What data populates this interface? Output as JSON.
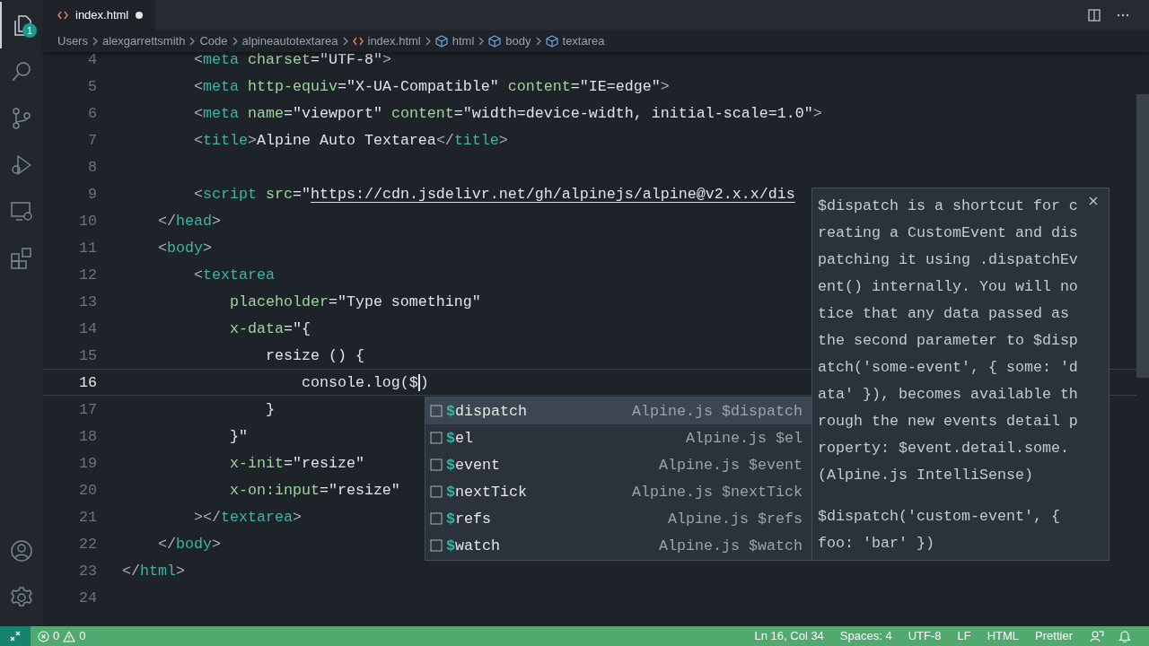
{
  "activity_bar": {
    "items": [
      {
        "kind": "files",
        "selected": true,
        "badge": "1"
      },
      {
        "kind": "search",
        "selected": false
      },
      {
        "kind": "source_control",
        "selected": false
      },
      {
        "kind": "run_debug",
        "selected": false
      },
      {
        "kind": "remote",
        "selected": false
      },
      {
        "kind": "extensions",
        "selected": false
      }
    ],
    "bottom": [
      {
        "kind": "account"
      },
      {
        "kind": "settings"
      }
    ]
  },
  "tabs": [
    {
      "label": "index.html",
      "selected": true,
      "modified": true
    }
  ],
  "breadcrumbs": [
    {
      "label": "Users",
      "kind": "folder"
    },
    {
      "label": "alexgarrettsmith",
      "kind": "folder"
    },
    {
      "label": "Code",
      "kind": "folder"
    },
    {
      "label": "alpineautotextarea",
      "kind": "folder"
    },
    {
      "label": "index.html",
      "kind": "file"
    },
    {
      "label": "html",
      "kind": "element"
    },
    {
      "label": "body",
      "kind": "element"
    },
    {
      "label": "textarea",
      "kind": "element"
    }
  ],
  "editor": {
    "lines": [
      {
        "number": "4",
        "current": false,
        "tokens": [
          {
            "kind": "punct",
            "text": "        <"
          },
          {
            "kind": "tag",
            "text": "meta "
          },
          {
            "kind": "attr",
            "text": "charset"
          },
          {
            "kind": "string",
            "text": "=\"UTF-8\""
          },
          {
            "kind": "punct",
            "text": ">"
          }
        ]
      },
      {
        "number": "5",
        "current": false,
        "tokens": [
          {
            "kind": "punct",
            "text": "        <"
          },
          {
            "kind": "tag",
            "text": "meta "
          },
          {
            "kind": "attr",
            "text": "http-equiv"
          },
          {
            "kind": "string",
            "text": "=\"X-UA-Compatible\" "
          },
          {
            "kind": "attr",
            "text": "content"
          },
          {
            "kind": "string",
            "text": "=\"IE=edge\""
          },
          {
            "kind": "punct",
            "text": ">"
          }
        ]
      },
      {
        "number": "6",
        "current": false,
        "tokens": [
          {
            "kind": "punct",
            "text": "        <"
          },
          {
            "kind": "tag",
            "text": "meta "
          },
          {
            "kind": "attr",
            "text": "name"
          },
          {
            "kind": "string",
            "text": "=\"viewport\" "
          },
          {
            "kind": "attr",
            "text": "content"
          },
          {
            "kind": "string",
            "text": "=\"width=device-width, initial-scale=1.0\""
          },
          {
            "kind": "punct",
            "text": ">"
          }
        ]
      },
      {
        "number": "7",
        "current": false,
        "tokens": [
          {
            "kind": "punct",
            "text": "        <"
          },
          {
            "kind": "tag",
            "text": "title"
          },
          {
            "kind": "punct",
            "text": ">"
          },
          {
            "kind": "text",
            "text": "Alpine Auto Textarea"
          },
          {
            "kind": "punct",
            "text": "</"
          },
          {
            "kind": "tag",
            "text": "title"
          },
          {
            "kind": "punct",
            "text": ">"
          }
        ]
      },
      {
        "number": "8",
        "current": false
      },
      {
        "number": "9",
        "current": false,
        "tokens": [
          {
            "kind": "punct",
            "text": "        <"
          },
          {
            "kind": "tag",
            "text": "script "
          },
          {
            "kind": "attr",
            "text": "src"
          },
          {
            "kind": "string",
            "text": "=\""
          },
          {
            "kind": "url",
            "text": "https://cdn.jsdelivr.net/gh/alpinejs/alpine@v2.x.x/dis"
          }
        ]
      },
      {
        "number": "10",
        "current": false,
        "tokens": [
          {
            "kind": "punct",
            "text": "    </"
          },
          {
            "kind": "tag",
            "text": "head"
          },
          {
            "kind": "punct",
            "text": ">"
          }
        ]
      },
      {
        "number": "11",
        "current": false,
        "tokens": [
          {
            "kind": "punct",
            "text": "    <"
          },
          {
            "kind": "tag",
            "text": "body"
          },
          {
            "kind": "punct",
            "text": ">"
          }
        ]
      },
      {
        "number": "12",
        "current": false,
        "tokens": [
          {
            "kind": "punct",
            "text": "        <"
          },
          {
            "kind": "tag",
            "text": "textarea"
          }
        ]
      },
      {
        "number": "13",
        "current": false,
        "tokens": [
          {
            "kind": "attr",
            "text": "            placeholder"
          },
          {
            "kind": "string",
            "text": "=\"Type something\""
          }
        ]
      },
      {
        "number": "14",
        "current": false,
        "tokens": [
          {
            "kind": "attr",
            "text": "            x-data"
          },
          {
            "kind": "string",
            "text": "=\"{"
          }
        ]
      },
      {
        "number": "15",
        "current": false,
        "tokens": [
          {
            "kind": "text",
            "text": "                resize () {"
          }
        ]
      },
      {
        "number": "16",
        "current": true,
        "tokens": [
          {
            "kind": "text",
            "text": "                    console.log($"
          },
          {
            "kind": "text",
            "text": ")",
            "caret_before": true
          }
        ]
      },
      {
        "number": "17",
        "current": false,
        "tokens": [
          {
            "kind": "text",
            "text": "                }"
          }
        ]
      },
      {
        "number": "18",
        "current": false,
        "tokens": [
          {
            "kind": "string",
            "text": "            }\""
          }
        ]
      },
      {
        "number": "19",
        "current": false,
        "tokens": [
          {
            "kind": "attr",
            "text": "            x-init"
          },
          {
            "kind": "string",
            "text": "=\"resize\""
          }
        ]
      },
      {
        "number": "20",
        "current": false,
        "tokens": [
          {
            "kind": "attr",
            "text": "            x-on:input"
          },
          {
            "kind": "string",
            "text": "=\"resize\""
          }
        ]
      },
      {
        "number": "21",
        "current": false,
        "tokens": [
          {
            "kind": "punct",
            "text": "        ></"
          },
          {
            "kind": "tag",
            "text": "textarea"
          },
          {
            "kind": "punct",
            "text": ">"
          }
        ]
      },
      {
        "number": "22",
        "current": false,
        "tokens": [
          {
            "kind": "punct",
            "text": "    </"
          },
          {
            "kind": "tag",
            "text": "body"
          },
          {
            "kind": "punct",
            "text": ">"
          }
        ]
      },
      {
        "number": "23",
        "current": false,
        "tokens": [
          {
            "kind": "punct",
            "text": "</"
          },
          {
            "kind": "tag",
            "text": "html"
          },
          {
            "kind": "punct",
            "text": ">"
          }
        ]
      },
      {
        "number": "24",
        "current": false
      }
    ]
  },
  "suggestions": {
    "items": [
      {
        "label": "$dispatch",
        "detail": "Alpine.js $dispatch",
        "selected": true
      },
      {
        "label": "$el",
        "detail": "Alpine.js $el",
        "selected": false
      },
      {
        "label": "$event",
        "detail": "Alpine.js $event",
        "selected": false
      },
      {
        "label": "$nextTick",
        "detail": "Alpine.js $nextTick",
        "selected": false
      },
      {
        "label": "$refs",
        "detail": "Alpine.js $refs",
        "selected": false
      },
      {
        "label": "$watch",
        "detail": "Alpine.js $watch",
        "selected": false
      }
    ]
  },
  "hover": {
    "description": "$dispatch is a shortcut for creating a CustomEvent and dispatching it using .dispatchEvent() internally. You will notice that any data passed as the second parameter to $dispatch('some-event', { some: 'data' }), becomes available through the new events detail property: $event.detail.some. (Alpine.js IntelliSense)",
    "example": "$dispatch('custom-event', { foo: 'bar' })"
  },
  "status_bar": {
    "errors": "0",
    "warnings": "0",
    "items": [
      "Ln 16, Col 34",
      "Spaces: 4",
      "UTF-8",
      "LF",
      "HTML",
      "Prettier"
    ]
  }
}
